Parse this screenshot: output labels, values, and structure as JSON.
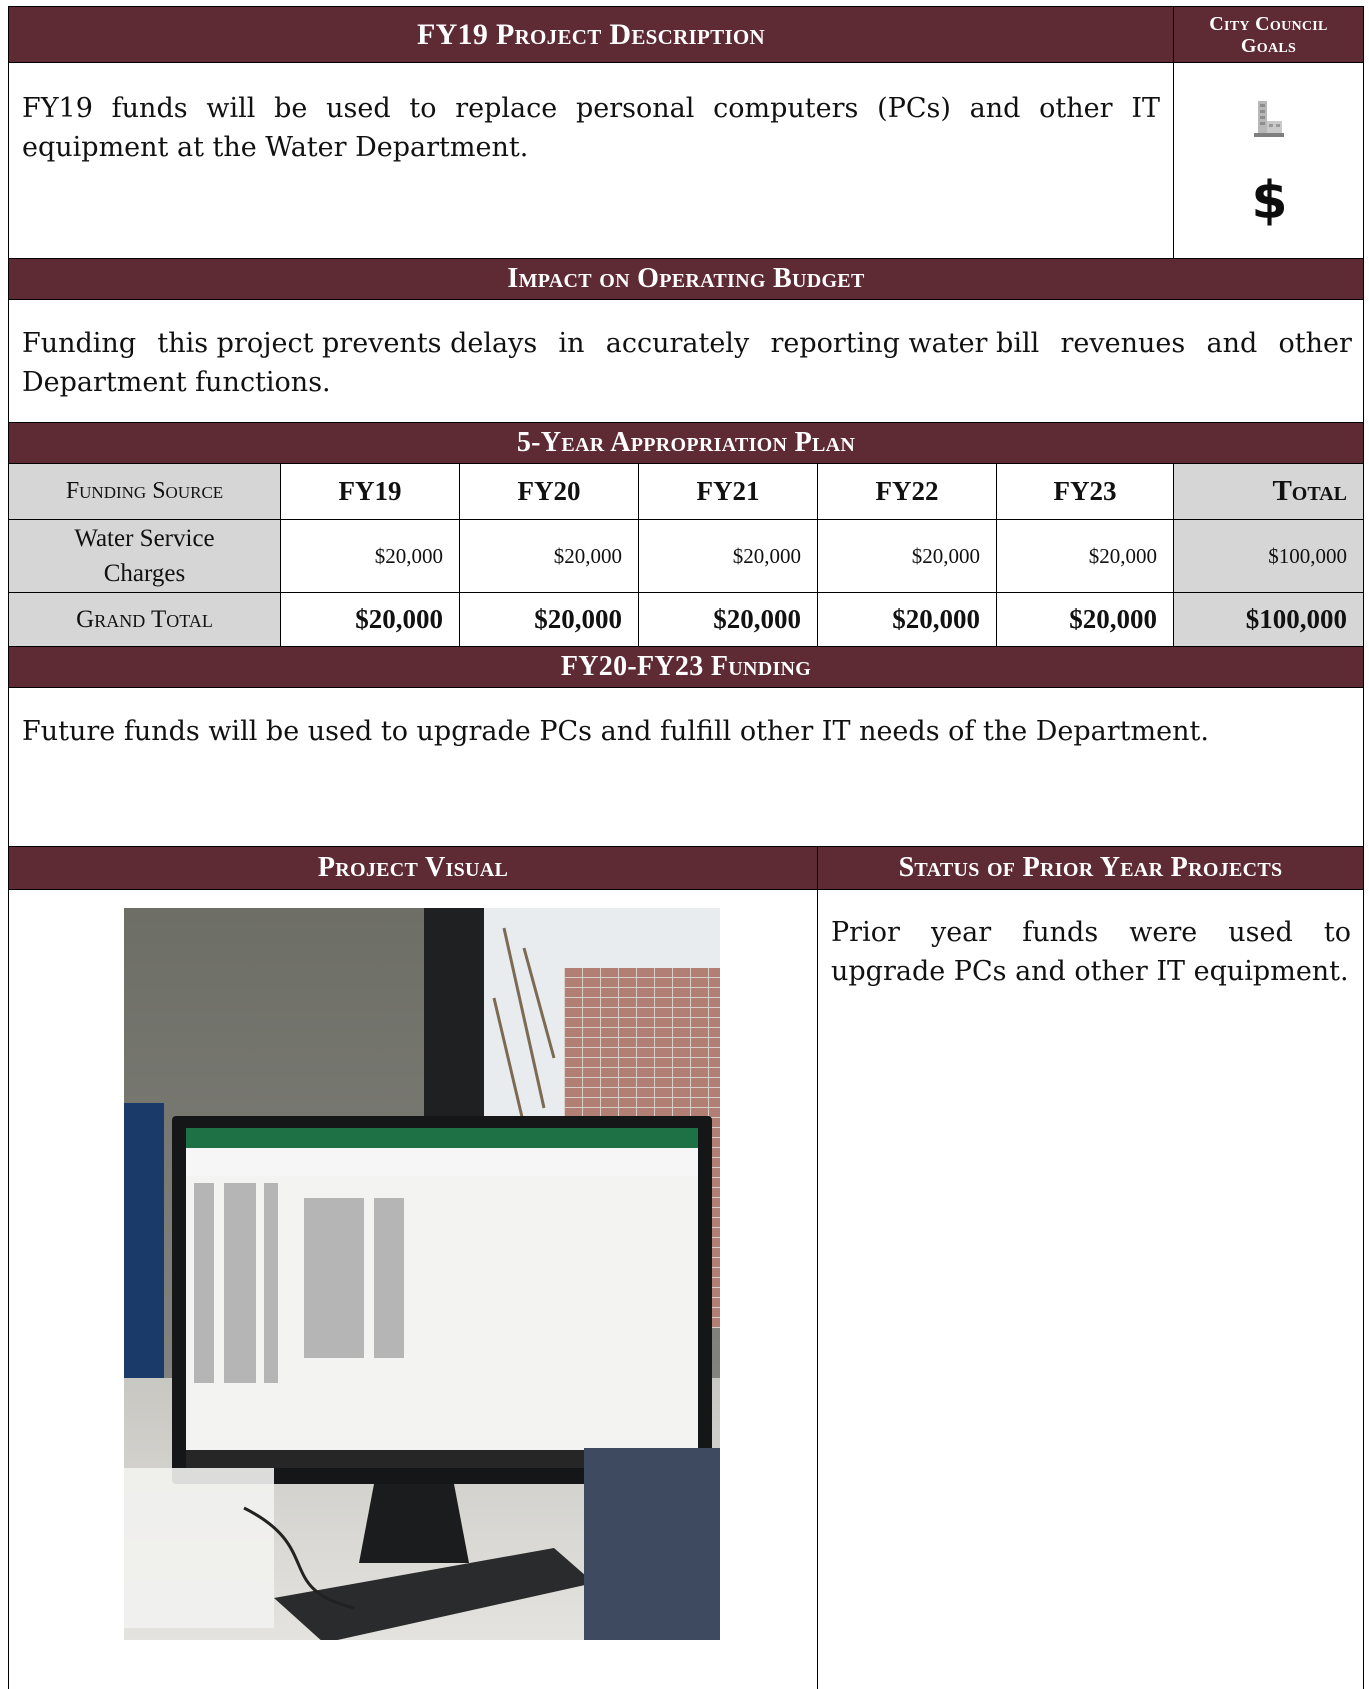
{
  "header": {
    "title": "FY19 Project Description",
    "goals_title_line1": "City Council",
    "goals_title_line2": "Goals"
  },
  "description": {
    "text": "FY19 funds will be used to replace personal computers (PCs) and other IT equipment at the Water Department."
  },
  "goals_icons": [
    "building-icon",
    "dollar-sign-icon"
  ],
  "goals_dollar": "$",
  "impact": {
    "title": "Impact on Operating Budget",
    "text": "Funding this project prevents delays in accurately reporting water bill revenues and other Department functions."
  },
  "plan": {
    "title": "5-Year Appropriation Plan",
    "headers": [
      "Funding Source",
      "FY19",
      "FY20",
      "FY21",
      "FY22",
      "FY23",
      "Total"
    ],
    "rows": [
      [
        "Water Service Charges",
        "$20,000",
        "$20,000",
        "$20,000",
        "$20,000",
        "$20,000",
        "$100,000"
      ]
    ],
    "grand_total": [
      "Grand Total",
      "$20,000",
      "$20,000",
      "$20,000",
      "$20,000",
      "$20,000",
      "$100,000"
    ]
  },
  "future": {
    "title": "FY20-FY23 Funding",
    "text": "Future funds will be used to upgrade PCs and fulfill other IT needs of the Department."
  },
  "visual": {
    "title": "Project Visual"
  },
  "status": {
    "title": "Status of Prior Year Projects",
    "text": "Prior year funds were used to upgrade PCs and other IT equipment."
  },
  "colors": {
    "header_bg": "#5e2a34",
    "grey_cell": "#d6d6d6"
  }
}
